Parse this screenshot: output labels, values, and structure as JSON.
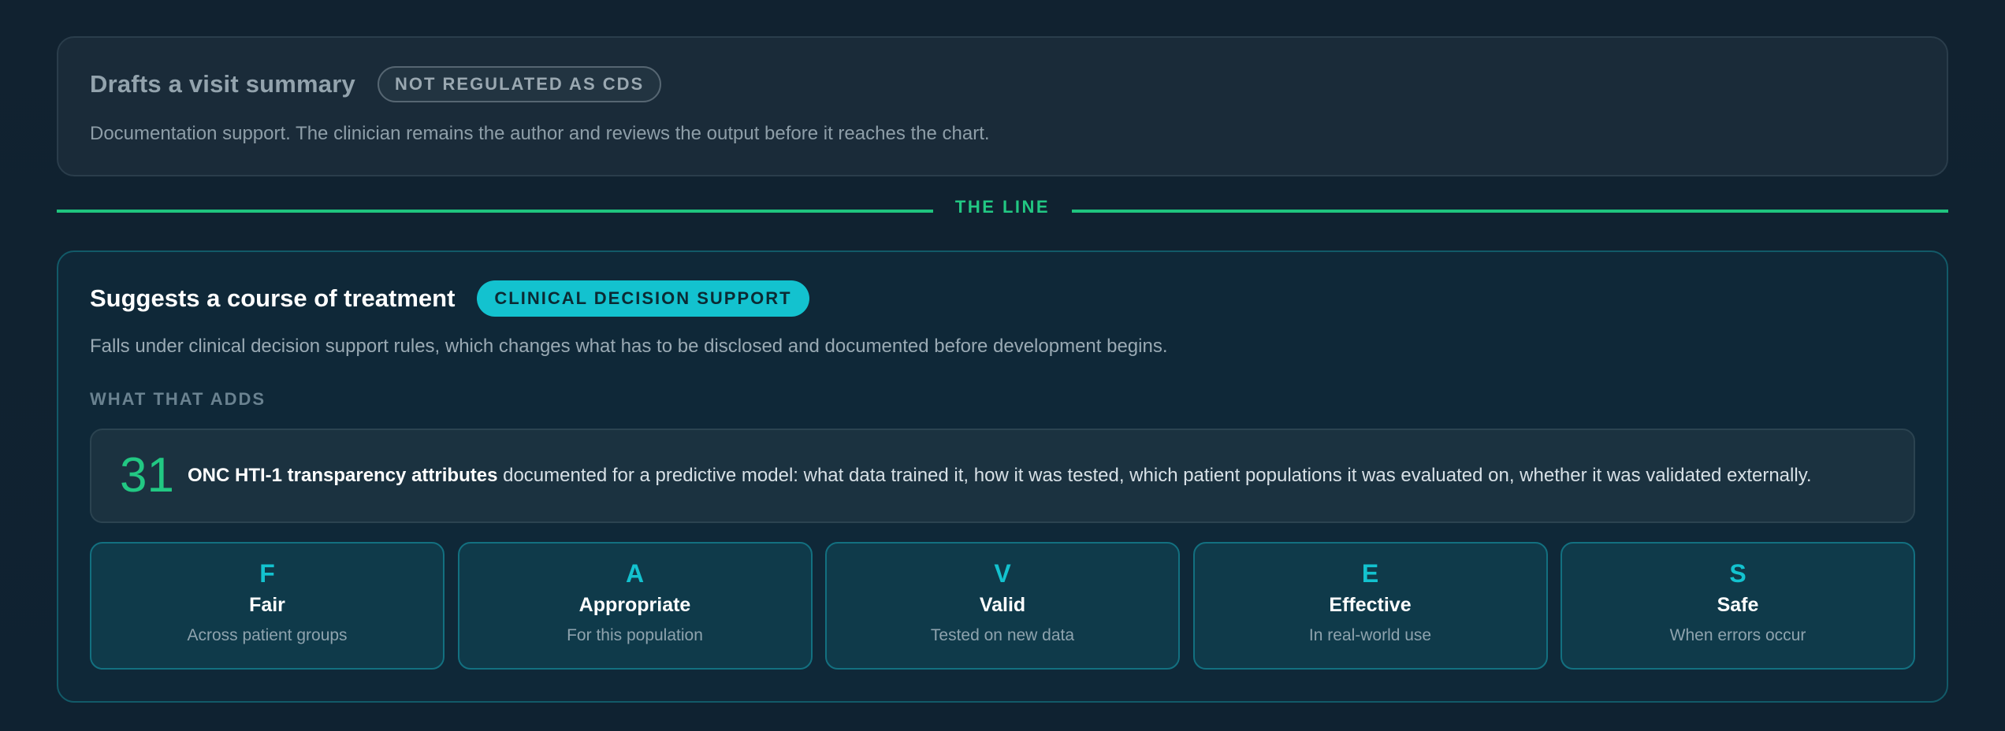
{
  "top_card": {
    "title": "Drafts a visit summary",
    "badge": "NOT REGULATED AS CDS",
    "description": "Documentation support. The clinician remains the author and reviews the output before it reaches the chart."
  },
  "divider": {
    "label": "THE LINE"
  },
  "bottom_card": {
    "title": "Suggests a course of treatment",
    "badge": "CLINICAL DECISION SUPPORT",
    "description": "Falls under clinical decision support rules, which changes what has to be disclosed and documented before development begins.",
    "section_label": "WHAT THAT ADDS",
    "stat": {
      "number": "31",
      "bold": "ONC HTI-1 transparency attributes",
      "text": " documented for a predictive model: what data trained it, how it was tested, which patient populations it was evaluated on, whether it was validated externally."
    },
    "faves": [
      {
        "letter": "F",
        "name": "Fair",
        "sub": "Across patient groups"
      },
      {
        "letter": "A",
        "name": "Appropriate",
        "sub": "For this population"
      },
      {
        "letter": "V",
        "name": "Valid",
        "sub": "Tested on new data"
      },
      {
        "letter": "E",
        "name": "Effective",
        "sub": "In real-world use"
      },
      {
        "letter": "S",
        "name": "Safe",
        "sub": "When errors occur"
      }
    ]
  },
  "colors": {
    "accent_green": "#22c883",
    "accent_cyan": "#13c2cf",
    "background": "#112230"
  }
}
